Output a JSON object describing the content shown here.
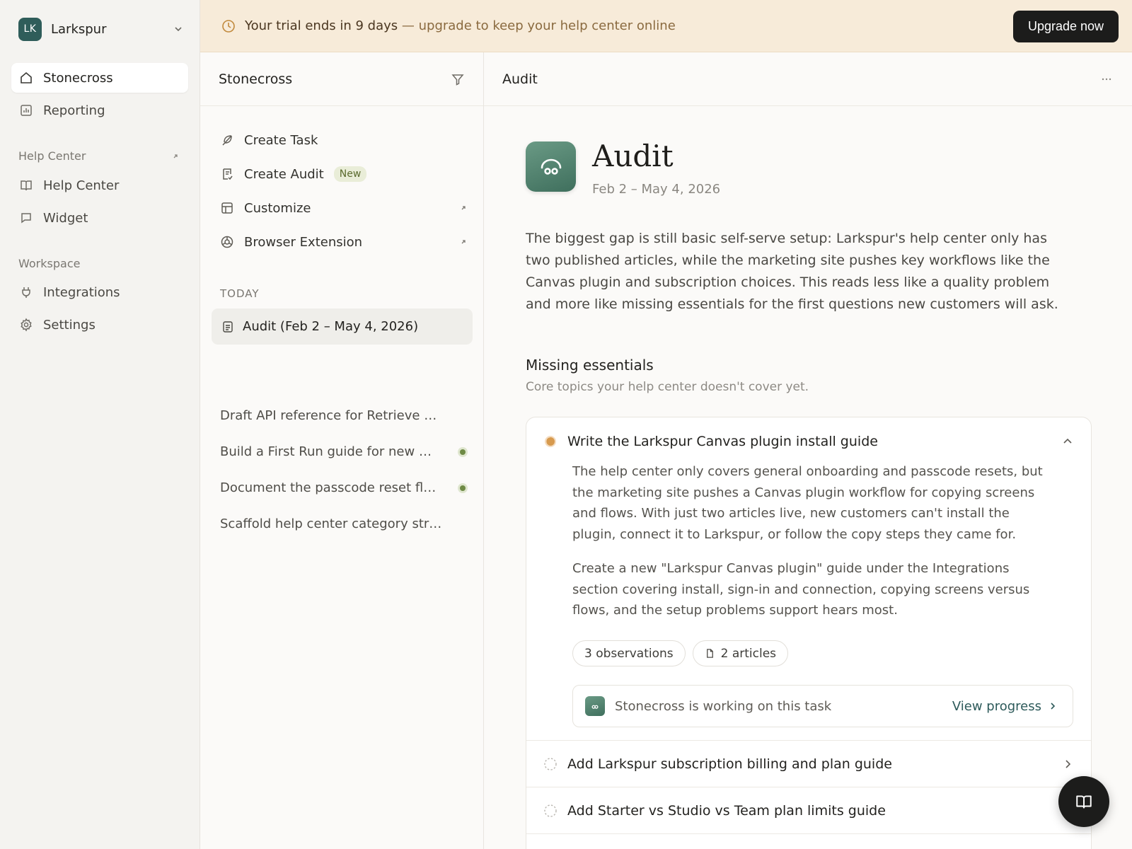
{
  "workspace": {
    "initials": "LK",
    "name": "Larkspur"
  },
  "nav": {
    "primary": [
      {
        "label": "Stonecross",
        "icon": "home-icon",
        "active": true
      },
      {
        "label": "Reporting",
        "icon": "chart-icon"
      }
    ],
    "help_center_section": "Help Center",
    "help_center_items": [
      {
        "label": "Help Center",
        "icon": "book-icon"
      },
      {
        "label": "Widget",
        "icon": "chat-bubble-icon"
      }
    ],
    "workspace_section": "Workspace",
    "workspace_items": [
      {
        "label": "Integrations",
        "icon": "plug-icon"
      },
      {
        "label": "Settings",
        "icon": "gear-icon"
      }
    ]
  },
  "banner": {
    "strong": "Your trial ends in 9 days",
    "rest": " — upgrade to keep your help center online",
    "button": "Upgrade now"
  },
  "middle": {
    "title": "Stonecross",
    "actions": [
      {
        "label": "Create Task",
        "icon": "leaf-icon"
      },
      {
        "label": "Create Audit",
        "icon": "checklist-icon",
        "badge": "New"
      },
      {
        "label": "Customize",
        "icon": "layout-icon",
        "external": true
      },
      {
        "label": "Browser Extension",
        "icon": "compass-icon",
        "external": true
      }
    ],
    "section": "TODAY",
    "items": [
      {
        "label": "Audit (Feb 2 – May 4, 2026)",
        "active": true
      },
      {
        "label": "Draft API reference for Retrieve Workspace settings endpoint"
      },
      {
        "label": "Build a First Run guide for new members",
        "status": "in-progress"
      },
      {
        "label": "Document the passcode reset flow",
        "status": "in-progress"
      },
      {
        "label": "Scaffold help center category structure and navigation"
      }
    ]
  },
  "main": {
    "header": "Audit",
    "title": "Audit",
    "date_range": "Feb 2 – May 4, 2026",
    "summary": "The biggest gap is still basic self-serve setup: Larkspur's help center only has two published articles, while the marketing site pushes key workflows like the Canvas plugin and subscription choices. This reads less like a quality problem and more like missing essentials for the first questions new customers will ask.",
    "section_title": "Missing essentials",
    "section_sub": "Core topics your help center doesn't cover yet.",
    "tasks": [
      {
        "title": "Write the Larkspur Canvas plugin install guide",
        "expanded": true,
        "para1": "The help center only covers general onboarding and passcode resets, but the marketing site pushes a Canvas plugin workflow for copying screens and flows. With just two articles live, new customers can't install the plugin, connect it to Larkspur, or follow the copy steps they came for.",
        "para2": "Create a new \"Larkspur Canvas plugin\" guide under the Integrations section covering install, sign-in and connection, copying screens versus flows, and the setup problems support hears most.",
        "observations": "3 observations",
        "articles": "2 articles",
        "working_text": "Stonecross is working on this task",
        "view_progress": "View progress"
      },
      {
        "title": "Add Larkspur subscription billing and plan guide"
      },
      {
        "title": "Add Starter vs Studio vs Team plan limits guide"
      }
    ]
  },
  "colors": {
    "accent": "#2d5a5a",
    "banner_bg": "#f7ebd9",
    "logo": "#3f6f5d",
    "status_dot": "#6e8a45"
  }
}
